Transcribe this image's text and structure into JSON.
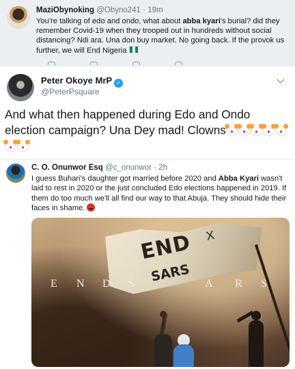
{
  "quoted_tweet": {
    "display_name": "MaziObynoking",
    "handle": "@Obyno241",
    "time": "19m",
    "text_before_bold": "You're talking of edo and ondo, what about ",
    "bold": "abba kyari",
    "text_after_bold": "'s burial? did they remember Covid-19 when they trooped out in hundreds without social distancing? Ndi ara. Una don buy market. No going back. If the provok us further, we will End Nigeria",
    "flag_icon": "nigeria-flag-icon"
  },
  "main_tweet": {
    "display_name": "Peter Okoye MrP",
    "handle": "@PeterPsquare",
    "verified": true,
    "text": "And what then happened during Edo and Ondo election campaign? Una Dey mad! Clowns",
    "emoji_icon": "clown-face-icon",
    "emoji_count": 7
  },
  "reply_tweet": {
    "display_name": "C. O. Onunwor Esq",
    "handle": "@c_onunwor",
    "time": "2h",
    "text_before_bold": "I guess Buhari's daughter got married before 2020 and ",
    "bold": "Abba Kyari",
    "text_after_bold": " wasn't laid to rest in 2020 or the just concluded Edo elections happened in 2019. If them do too much we'll all find our way to that Abuja. They should hide their faces in shame.",
    "emoji_icon": "angry-face-icon"
  },
  "image": {
    "banner_line1": "END",
    "banner_line2": "SARS",
    "banner_mark": "X",
    "overlay_letters": [
      "E",
      "N",
      "D",
      "S",
      "A",
      "R",
      "S"
    ]
  },
  "colors": {
    "accent": "#1da1f2",
    "muted_text": "#657786",
    "quoted_bg": "#eceff1"
  }
}
